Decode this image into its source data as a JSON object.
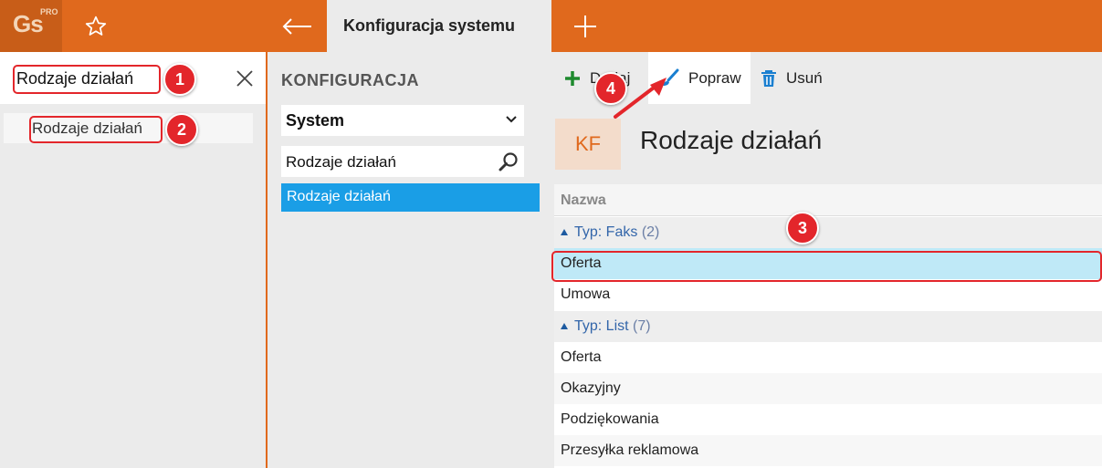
{
  "app": {
    "logo_text": "Gs",
    "logo_sup": "PRO",
    "active_tab": "Konfiguracja systemu"
  },
  "left": {
    "search_value": "Rodzaje działań",
    "results": [
      "Rodzaje działań"
    ]
  },
  "middle": {
    "title": "KONFIGURACJA",
    "select_value": "System",
    "search_value": "Rodzaje działań",
    "nav_items": [
      "Rodzaje działań"
    ]
  },
  "toolbar": {
    "add_label": "Dodaj",
    "edit_label": "Popraw",
    "delete_label": "Usuń"
  },
  "content": {
    "badge": "KF",
    "title": "Rodzaje działań",
    "column_header": "Nazwa",
    "groups": [
      {
        "label": "Typ: Faks",
        "count": "(2)",
        "items": [
          "Oferta",
          "Umowa"
        ]
      },
      {
        "label": "Typ: List",
        "count": "(7)",
        "items": [
          "Oferta",
          "Okazyjny",
          "Podziękowania",
          "Przesyłka reklamowa"
        ]
      }
    ]
  },
  "annotations": [
    "1",
    "2",
    "3",
    "4"
  ],
  "colors": {
    "accent": "#e0691d",
    "selection": "#1a9ee6",
    "row_selected": "#bfe9f7",
    "marker": "#e3262b"
  }
}
